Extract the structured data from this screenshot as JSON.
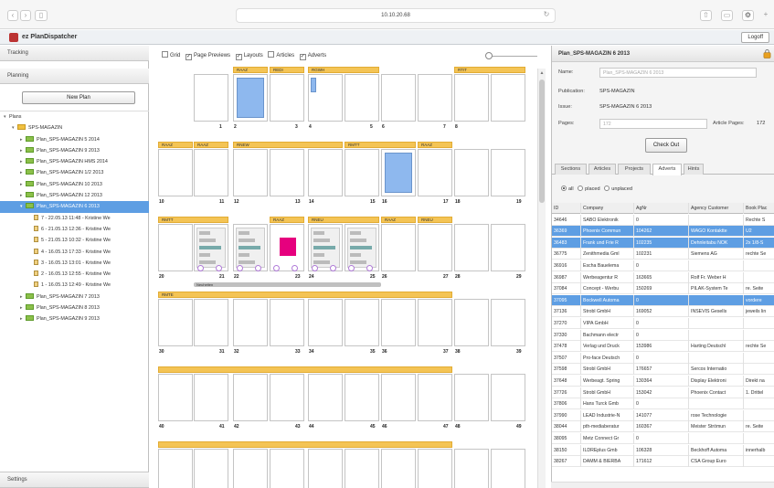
{
  "browser": {
    "url": "10.10.20.68",
    "back_icon": "chevron-left-icon",
    "forward_icon": "chevron-right-icon",
    "sidebar_icon": "sidebar-icon",
    "reload_icon": "reload-icon",
    "share_icon": "share-icon",
    "tabs_icon": "tabs-icon",
    "settings_icon": "gear-icon"
  },
  "app": {
    "title": "ez PlanDispatcher",
    "logoff": "Logoff"
  },
  "sidebar": {
    "tracking": "Tracking",
    "planning": "Planning",
    "new_plan": "New Plan",
    "settings": "Settings",
    "tree": [
      {
        "label": "Plans",
        "level": 0,
        "type": "root"
      },
      {
        "label": "SPS-MAGAZIN",
        "level": 1,
        "type": "folder"
      },
      {
        "label": "Plan_SPS-MAGAZIN 5 2014",
        "level": 2,
        "type": "plan"
      },
      {
        "label": "Plan_SPS-MAGAZIN 9 2013",
        "level": 2,
        "type": "plan"
      },
      {
        "label": "Plan_SPS-MAGAZIN HMS 2014",
        "level": 2,
        "type": "plan"
      },
      {
        "label": "Plan_SPS-MAGAZIN 1/2 2013",
        "level": 2,
        "type": "plan"
      },
      {
        "label": "Plan_SPS-MAGAZIN 10 2013",
        "level": 2,
        "type": "plan"
      },
      {
        "label": "Plan_SPS-MAGAZIN 12 2013",
        "level": 2,
        "type": "plan"
      },
      {
        "label": "Plan_SPS-MAGAZIN 6 2013",
        "level": 2,
        "type": "plan",
        "selected": true
      },
      {
        "label": "7 - 22.05.13 11:48 - Kristine We",
        "level": 3,
        "type": "version"
      },
      {
        "label": "6 - 21.05.13 12:36 - Kristine We",
        "level": 3,
        "type": "version"
      },
      {
        "label": "5 - 21.05.13 10:32 - Kristine We",
        "level": 3,
        "type": "version"
      },
      {
        "label": "4 - 16.05.13 17:33 - Kristine We",
        "level": 3,
        "type": "version"
      },
      {
        "label": "3 - 16.05.13 13:01 - Kristine We",
        "level": 3,
        "type": "version"
      },
      {
        "label": "2 - 16.05.13 12:55 - Kristine We",
        "level": 3,
        "type": "version"
      },
      {
        "label": "1 - 16.05.13 12:49 - Kristine We",
        "level": 3,
        "type": "version"
      },
      {
        "label": "Plan_SPS-MAGAZIN 7 2013",
        "level": 2,
        "type": "plan"
      },
      {
        "label": "Plan_SPS-MAGAZIN 8 2013",
        "level": 2,
        "type": "plan"
      },
      {
        "label": "Plan_SPS-MAGAZIN 9 2013",
        "level": 2,
        "type": "plan"
      }
    ]
  },
  "view_controls": {
    "grid": "Grid",
    "page_previews": "Page Previews",
    "layouts": "Layouts",
    "articles": "Articles",
    "adverts": "Adverts",
    "checked": [
      false,
      true,
      true,
      false,
      true
    ]
  },
  "plan_grid": {
    "rows": [
      {
        "bands": [
          {
            "label": "RAAZ",
            "from": 1,
            "to": 1
          },
          {
            "label": "REDI",
            "from": 2,
            "to": 2
          },
          {
            "label": "RGWH",
            "from": 3,
            "to": 4
          },
          {
            "label": "RTIT",
            "from": 7,
            "to": 8
          }
        ],
        "page_numbers": [
          "1",
          "2",
          "3",
          "4",
          "5",
          "6",
          "7",
          "8"
        ],
        "blue_pages": [
          1
        ],
        "small_blue_pages": [
          3
        ]
      },
      {
        "bands": [
          {
            "label": "RAAZ",
            "from": 0,
            "to": 0
          },
          {
            "label": "RAAZ",
            "from": 1,
            "to": 1
          },
          {
            "label": "RNEW",
            "from": 2,
            "to": 4
          },
          {
            "label": "RMTT",
            "from": 5,
            "to": 6
          },
          {
            "label": "RAAZ",
            "from": 7,
            "to": 7
          }
        ],
        "page_numbers": [
          "10",
          "11",
          "12",
          "13",
          "14",
          "15",
          "16",
          "17",
          "18",
          "19"
        ],
        "blue_pages": [
          6
        ]
      },
      {
        "bands": [
          {
            "label": "RMTT",
            "from": 0,
            "to": 1
          },
          {
            "label": "RAAZ",
            "from": 3,
            "to": 3
          },
          {
            "label": "RNEU",
            "from": 4,
            "to": 5
          },
          {
            "label": "RAAZ",
            "from": 6,
            "to": 6
          },
          {
            "label": "RNEU",
            "from": 7,
            "to": 7
          }
        ],
        "page_numbers": [
          "20",
          "21",
          "22",
          "23",
          "24",
          "25",
          "26",
          "27",
          "28",
          "29"
        ],
        "preview_pages": [
          1,
          2,
          3,
          4,
          5
        ],
        "pink_page": 3,
        "news_bar": "Neuheiten"
      },
      {
        "bands": [
          {
            "label": "RMTE",
            "from": 0,
            "to": 7
          }
        ],
        "page_numbers": [
          "30",
          "31",
          "32",
          "33",
          "34",
          "35",
          "36",
          "37",
          "38",
          "39"
        ]
      },
      {
        "bands": [
          {
            "label": "",
            "from": 0,
            "to": 7
          }
        ],
        "page_numbers": [
          "40",
          "41",
          "42",
          "43",
          "44",
          "45",
          "46",
          "47",
          "48",
          "49"
        ]
      },
      {
        "bands": [
          {
            "label": "",
            "from": 0,
            "to": 7
          }
        ],
        "page_numbers": []
      }
    ]
  },
  "details": {
    "title": "Plan_SPS-MAGAZIN 6 2013",
    "name_label": "Name:",
    "name_value": "Plan_SPS-MAGAZIN 6 2013",
    "publication_label": "Publication:",
    "publication_value": "SPS-MAGAZIN",
    "issue_label": "Issue:",
    "issue_value": "SPS-MAGAZIN 6 2013",
    "pages_label": "Pages:",
    "pages_value": "172",
    "article_pages_label": "Article Pages:",
    "article_pages_value": "172",
    "checkout": "Check Out",
    "tabs": [
      "Sections",
      "Articles",
      "Projects",
      "Adverts",
      "Hints"
    ],
    "active_tab": 3,
    "filter": {
      "all": "all",
      "placed": "placed",
      "unplaced": "unplaced"
    },
    "columns": [
      "ID",
      "Company",
      "AgNr",
      "Agency Customer",
      "Book Plac"
    ],
    "rows": [
      {
        "cells": [
          "34646",
          "SABO Elektronik",
          "0",
          "",
          "Rechte S"
        ]
      },
      {
        "cells": [
          "36369",
          "Phoenix Commun",
          "104262",
          "WAGO Kontaktte",
          "U2"
        ],
        "selected": true
      },
      {
        "cells": [
          "36483",
          "Frank und Frie R",
          "102235",
          "Dehnleitabu NOK",
          "2x 1/8-S"
        ],
        "selected": true
      },
      {
        "cells": [
          "36775",
          "Zenithmedia Gml",
          "102231",
          "Siemens AG",
          "rechte Se"
        ]
      },
      {
        "cells": [
          "36916",
          "Escha Bauelema",
          "0",
          "",
          ""
        ]
      },
      {
        "cells": [
          "36987",
          "Werbeagentur R",
          "163665",
          "Rolf Fr. Weber H",
          ""
        ]
      },
      {
        "cells": [
          "37084",
          "Concept - Werbu",
          "150269",
          "PILAK-System Te",
          "re. Seite"
        ]
      },
      {
        "cells": [
          "37095",
          "Bockwell Automa",
          "0",
          "",
          "vordere"
        ],
        "selected": true
      },
      {
        "cells": [
          "37136",
          "Strobl GmbH",
          "169052",
          "INSEVIS Gesells",
          "jeweils lin"
        ]
      },
      {
        "cells": [
          "37270",
          "VIPA GmbH",
          "0",
          "",
          ""
        ]
      },
      {
        "cells": [
          "37330",
          "Bachmann electr",
          "0",
          "",
          ""
        ]
      },
      {
        "cells": [
          "37478",
          "Verlag und Druck",
          "153986",
          "Harting Deutschl",
          "rechte Se"
        ]
      },
      {
        "cells": [
          "37507",
          "Pro-face Deutsch",
          "0",
          "",
          ""
        ]
      },
      {
        "cells": [
          "37598",
          "Strobl GmbH",
          "176657",
          "Sercos Internatio",
          ""
        ]
      },
      {
        "cells": [
          "37648",
          "Werbeagt. Spring",
          "130364",
          "Display Elektroni",
          "Direkt na"
        ]
      },
      {
        "cells": [
          "37726",
          "Strobl GmbH",
          "153042",
          "Phoenix Contact",
          "1. Drittel"
        ]
      },
      {
        "cells": [
          "37806",
          "Hans Turck Gmb",
          "0",
          "",
          ""
        ]
      },
      {
        "cells": [
          "37990",
          "LEAD Industrie-N",
          "141077",
          "rose Technologie",
          ""
        ]
      },
      {
        "cells": [
          "38044",
          "pth-mediaberatur",
          "160367",
          "Meister Strömun",
          "re. Seite"
        ]
      },
      {
        "cells": [
          "38095",
          "Metz Connect Gr",
          "0",
          "",
          ""
        ]
      },
      {
        "cells": [
          "38150",
          "ILDREplus Gmb",
          "106328",
          "Beckhoff Automa",
          "innerhalb"
        ]
      },
      {
        "cells": [
          "38267",
          "DAMM & BIERBA",
          "171612",
          "CSA Group Euro",
          ""
        ]
      }
    ]
  },
  "colors": {
    "band": "#f4c455",
    "selection": "#5e9ee3",
    "page_fill": "#8eb8ee",
    "advert_pink": "#e6007e"
  }
}
